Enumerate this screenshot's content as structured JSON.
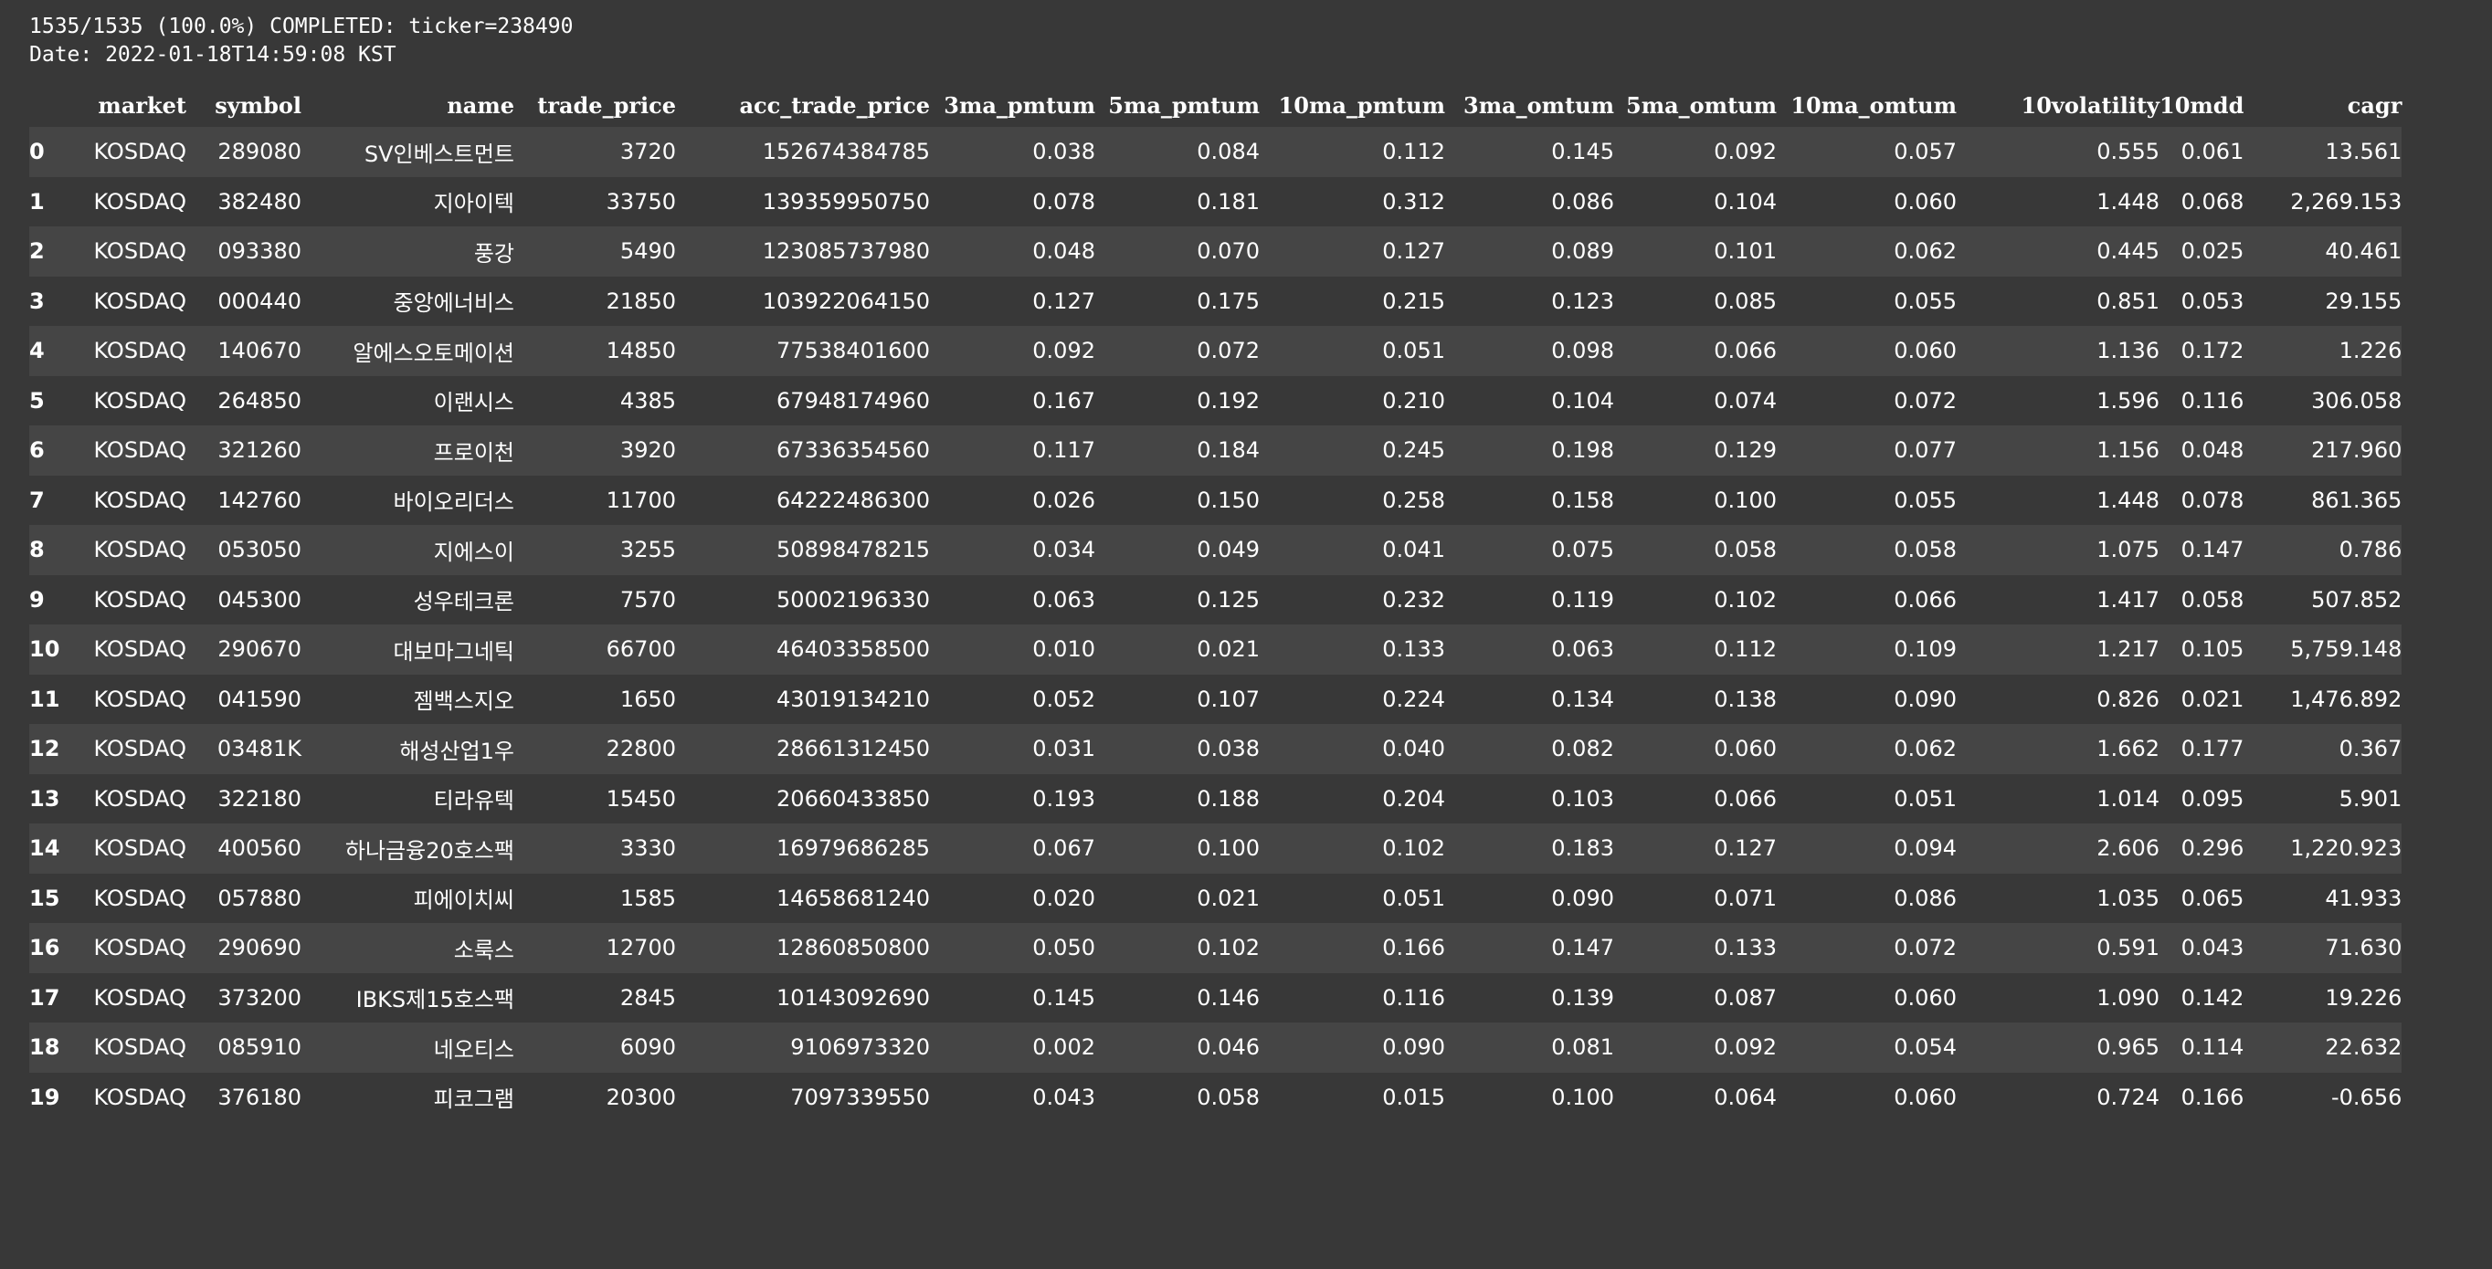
{
  "progress_line": "1535/1535 (100.0%) COMPLETED: ticker=238490",
  "date_line": "Date: 2022-01-18T14:59:08 KST",
  "table": {
    "columns": [
      "",
      "market",
      "symbol",
      "name",
      "trade_price",
      "acc_trade_price",
      "3ma_pmtum",
      "5ma_pmtum",
      "10ma_pmtum",
      "3ma_omtum",
      "5ma_omtum",
      "10ma_omtum",
      "10volatility",
      "10mdd",
      "cagr"
    ],
    "rows": [
      [
        "0",
        "KOSDAQ",
        "289080",
        "SV인베스트먼트",
        "3720",
        "152674384785",
        "0.038",
        "0.084",
        "0.112",
        "0.145",
        "0.092",
        "0.057",
        "0.555",
        "0.061",
        "13.561"
      ],
      [
        "1",
        "KOSDAQ",
        "382480",
        "지아이텍",
        "33750",
        "139359950750",
        "0.078",
        "0.181",
        "0.312",
        "0.086",
        "0.104",
        "0.060",
        "1.448",
        "0.068",
        "2,269.153"
      ],
      [
        "2",
        "KOSDAQ",
        "093380",
        "풍강",
        "5490",
        "123085737980",
        "0.048",
        "0.070",
        "0.127",
        "0.089",
        "0.101",
        "0.062",
        "0.445",
        "0.025",
        "40.461"
      ],
      [
        "3",
        "KOSDAQ",
        "000440",
        "중앙에너비스",
        "21850",
        "103922064150",
        "0.127",
        "0.175",
        "0.215",
        "0.123",
        "0.085",
        "0.055",
        "0.851",
        "0.053",
        "29.155"
      ],
      [
        "4",
        "KOSDAQ",
        "140670",
        "알에스오토메이션",
        "14850",
        "77538401600",
        "0.092",
        "0.072",
        "0.051",
        "0.098",
        "0.066",
        "0.060",
        "1.136",
        "0.172",
        "1.226"
      ],
      [
        "5",
        "KOSDAQ",
        "264850",
        "이랜시스",
        "4385",
        "67948174960",
        "0.167",
        "0.192",
        "0.210",
        "0.104",
        "0.074",
        "0.072",
        "1.596",
        "0.116",
        "306.058"
      ],
      [
        "6",
        "KOSDAQ",
        "321260",
        "프로이천",
        "3920",
        "67336354560",
        "0.117",
        "0.184",
        "0.245",
        "0.198",
        "0.129",
        "0.077",
        "1.156",
        "0.048",
        "217.960"
      ],
      [
        "7",
        "KOSDAQ",
        "142760",
        "바이오리더스",
        "11700",
        "64222486300",
        "0.026",
        "0.150",
        "0.258",
        "0.158",
        "0.100",
        "0.055",
        "1.448",
        "0.078",
        "861.365"
      ],
      [
        "8",
        "KOSDAQ",
        "053050",
        "지에스이",
        "3255",
        "50898478215",
        "0.034",
        "0.049",
        "0.041",
        "0.075",
        "0.058",
        "0.058",
        "1.075",
        "0.147",
        "0.786"
      ],
      [
        "9",
        "KOSDAQ",
        "045300",
        "성우테크론",
        "7570",
        "50002196330",
        "0.063",
        "0.125",
        "0.232",
        "0.119",
        "0.102",
        "0.066",
        "1.417",
        "0.058",
        "507.852"
      ],
      [
        "10",
        "KOSDAQ",
        "290670",
        "대보마그네틱",
        "66700",
        "46403358500",
        "0.010",
        "0.021",
        "0.133",
        "0.063",
        "0.112",
        "0.109",
        "1.217",
        "0.105",
        "5,759.148"
      ],
      [
        "11",
        "KOSDAQ",
        "041590",
        "젬백스지오",
        "1650",
        "43019134210",
        "0.052",
        "0.107",
        "0.224",
        "0.134",
        "0.138",
        "0.090",
        "0.826",
        "0.021",
        "1,476.892"
      ],
      [
        "12",
        "KOSDAQ",
        "03481K",
        "해성산업1우",
        "22800",
        "28661312450",
        "0.031",
        "0.038",
        "0.040",
        "0.082",
        "0.060",
        "0.062",
        "1.662",
        "0.177",
        "0.367"
      ],
      [
        "13",
        "KOSDAQ",
        "322180",
        "티라유텍",
        "15450",
        "20660433850",
        "0.193",
        "0.188",
        "0.204",
        "0.103",
        "0.066",
        "0.051",
        "1.014",
        "0.095",
        "5.901"
      ],
      [
        "14",
        "KOSDAQ",
        "400560",
        "하나금융20호스팩",
        "3330",
        "16979686285",
        "0.067",
        "0.100",
        "0.102",
        "0.183",
        "0.127",
        "0.094",
        "2.606",
        "0.296",
        "1,220.923"
      ],
      [
        "15",
        "KOSDAQ",
        "057880",
        "피에이치씨",
        "1585",
        "14658681240",
        "0.020",
        "0.021",
        "0.051",
        "0.090",
        "0.071",
        "0.086",
        "1.035",
        "0.065",
        "41.933"
      ],
      [
        "16",
        "KOSDAQ",
        "290690",
        "소룩스",
        "12700",
        "12860850800",
        "0.050",
        "0.102",
        "0.166",
        "0.147",
        "0.133",
        "0.072",
        "0.591",
        "0.043",
        "71.630"
      ],
      [
        "17",
        "KOSDAQ",
        "373200",
        "IBKS제15호스팩",
        "2845",
        "10143092690",
        "0.145",
        "0.146",
        "0.116",
        "0.139",
        "0.087",
        "0.060",
        "1.090",
        "0.142",
        "19.226"
      ],
      [
        "18",
        "KOSDAQ",
        "085910",
        "네오티스",
        "6090",
        "9106973320",
        "0.002",
        "0.046",
        "0.090",
        "0.081",
        "0.092",
        "0.054",
        "0.965",
        "0.114",
        "22.632"
      ],
      [
        "19",
        "KOSDAQ",
        "376180",
        "피코그램",
        "20300",
        "7097339550",
        "0.043",
        "0.058",
        "0.015",
        "0.100",
        "0.064",
        "0.060",
        "0.724",
        "0.166",
        "-0.656"
      ]
    ]
  }
}
